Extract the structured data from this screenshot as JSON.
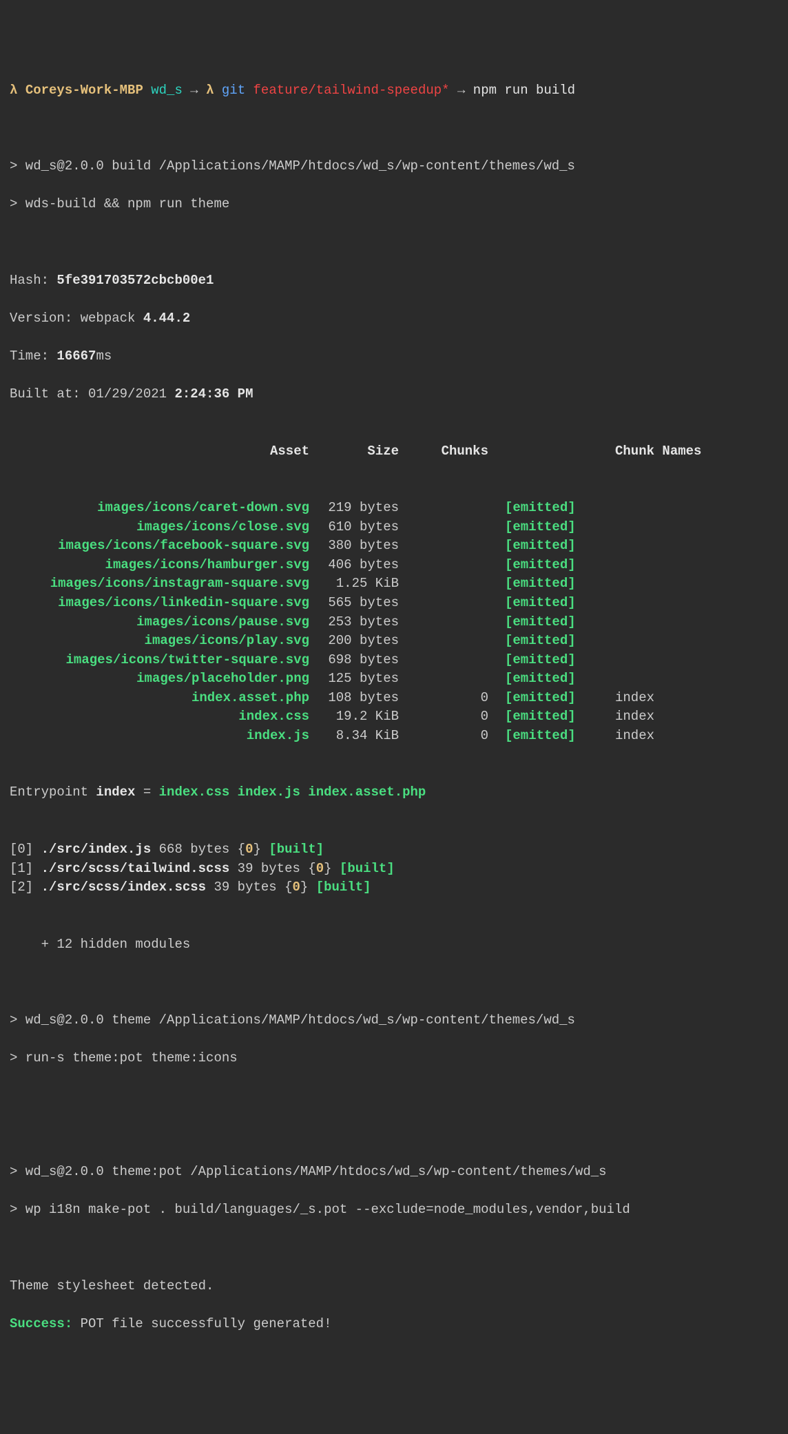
{
  "prompt": {
    "lambda": "λ",
    "host": "Coreys-Work-MBP",
    "dir": "wd_s",
    "arrow": "→",
    "git_label": "git",
    "branch": "feature/tailwind-speedup",
    "dirty": "*",
    "command": "npm run build"
  },
  "script_header": {
    "line1": "> wd_s@2.0.0 build /Applications/MAMP/htdocs/wd_s/wp-content/themes/wd_s",
    "line2": "> wds-build && npm run theme"
  },
  "stats": {
    "hash_label": "Hash: ",
    "hash": "5fe391703572cbcb00e1",
    "version_label": "Version: webpack ",
    "version": "4.44.2",
    "time_label": "Time: ",
    "time_value": "16667",
    "time_suffix": "ms",
    "built_label": "Built at: 01/29/2021 ",
    "built_time": "2:24:36 PM"
  },
  "columns": {
    "asset": "Asset",
    "size": "Size",
    "chunks": "Chunks",
    "names": "Chunk Names"
  },
  "assets": [
    {
      "name": "images/icons/caret-down.svg",
      "size": "219 bytes",
      "chunks": "",
      "emitted": "[emitted]",
      "names": ""
    },
    {
      "name": "images/icons/close.svg",
      "size": "610 bytes",
      "chunks": "",
      "emitted": "[emitted]",
      "names": ""
    },
    {
      "name": "images/icons/facebook-square.svg",
      "size": "380 bytes",
      "chunks": "",
      "emitted": "[emitted]",
      "names": ""
    },
    {
      "name": "images/icons/hamburger.svg",
      "size": "406 bytes",
      "chunks": "",
      "emitted": "[emitted]",
      "names": ""
    },
    {
      "name": "images/icons/instagram-square.svg",
      "size": "1.25 KiB",
      "chunks": "",
      "emitted": "[emitted]",
      "names": ""
    },
    {
      "name": "images/icons/linkedin-square.svg",
      "size": "565 bytes",
      "chunks": "",
      "emitted": "[emitted]",
      "names": ""
    },
    {
      "name": "images/icons/pause.svg",
      "size": "253 bytes",
      "chunks": "",
      "emitted": "[emitted]",
      "names": ""
    },
    {
      "name": "images/icons/play.svg",
      "size": "200 bytes",
      "chunks": "",
      "emitted": "[emitted]",
      "names": ""
    },
    {
      "name": "images/icons/twitter-square.svg",
      "size": "698 bytes",
      "chunks": "",
      "emitted": "[emitted]",
      "names": ""
    },
    {
      "name": "images/placeholder.png",
      "size": "125 bytes",
      "chunks": "",
      "emitted": "[emitted]",
      "names": ""
    },
    {
      "name": "index.asset.php",
      "size": "108 bytes",
      "chunks": "0",
      "emitted": "[emitted]",
      "names": "index"
    },
    {
      "name": "index.css",
      "size": "19.2 KiB",
      "chunks": "0",
      "emitted": "[emitted]",
      "names": "index"
    },
    {
      "name": "index.js",
      "size": "8.34 KiB",
      "chunks": "0",
      "emitted": "[emitted]",
      "names": "index"
    }
  ],
  "entrypoint": {
    "label": "Entrypoint ",
    "name": "index",
    "equals": " = ",
    "files": "index.css index.js index.asset.php"
  },
  "modules": [
    {
      "idx": "[0]",
      "path": "./src/index.js",
      "size": "668 bytes",
      "open": " {",
      "chunk": "0",
      "close": "} ",
      "status": "[built]"
    },
    {
      "idx": "[1]",
      "path": "./src/scss/tailwind.scss",
      "size": "39 bytes",
      "open": " {",
      "chunk": "0",
      "close": "} ",
      "status": "[built]"
    },
    {
      "idx": "[2]",
      "path": "./src/scss/index.scss",
      "size": "39 bytes",
      "open": " {",
      "chunk": "0",
      "close": "} ",
      "status": "[built]"
    }
  ],
  "hidden": "    + 12 hidden modules",
  "theme_script": {
    "line1": "> wd_s@2.0.0 theme /Applications/MAMP/htdocs/wd_s/wp-content/themes/wd_s",
    "line2": "> run-s theme:pot theme:icons"
  },
  "pot_script": {
    "line1": "> wd_s@2.0.0 theme:pot /Applications/MAMP/htdocs/wd_s/wp-content/themes/wd_s",
    "line2": "> wp i18n make-pot . build/languages/_s.pot --exclude=node_modules,vendor,build"
  },
  "footer": {
    "detected": "Theme stylesheet detected.",
    "success_label": "Success:",
    "success_msg": " POT file successfully generated!"
  }
}
